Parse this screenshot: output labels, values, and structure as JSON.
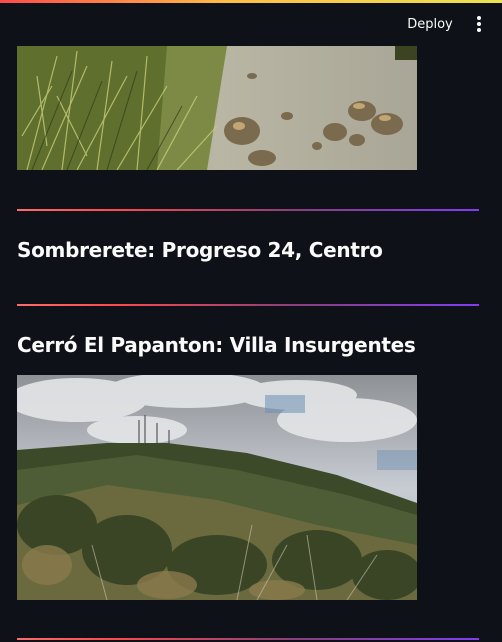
{
  "header": {
    "deploy_label": "Deploy",
    "menu_icon": "vertical-dots-icon"
  },
  "content": {
    "photo_top": {
      "subject": "grass-and-rocky-stream-photo"
    },
    "heading_1": "Sombrerete: Progreso 24, Centro",
    "heading_2": "Cerró El Papanton: Villa Insurgentes",
    "photo_bottom": {
      "subject": "mountain-with-antennas-photo"
    }
  },
  "colors": {
    "background": "#0e1117",
    "text": "#fafafa",
    "divider_start": "#ff4b4b",
    "divider_end": "#803df5"
  }
}
